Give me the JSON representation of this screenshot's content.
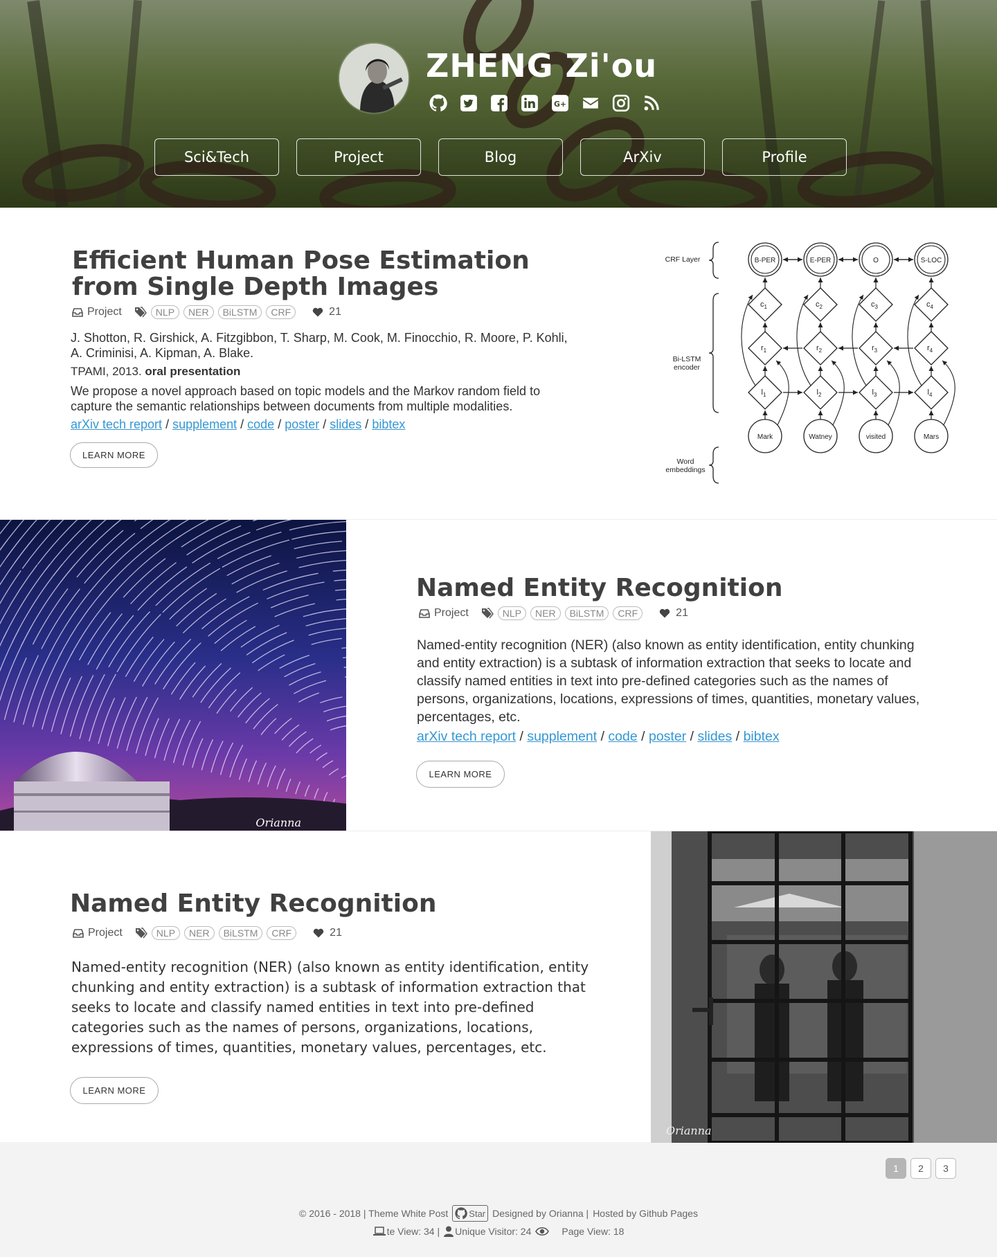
{
  "site": {
    "name": "ZHENG Zi'ou",
    "social_icons": [
      "github-icon",
      "twitter-icon",
      "facebook-icon",
      "linkedin-icon",
      "google-plus-icon",
      "email-icon",
      "instagram-icon",
      "rss-icon"
    ]
  },
  "nav": [
    "Sci&Tech",
    "Project",
    "Blog",
    "ArXiv",
    "Profile"
  ],
  "posts": [
    {
      "title": "Efficient Human Pose Estimation from Single Depth Images",
      "category": "Project",
      "tags": [
        "NLP",
        "NER",
        "BiLSTM",
        "CRF"
      ],
      "likes": "21",
      "authors": "J. Shotton, R. Girshick, A. Fitzgibbon, T. Sharp, M. Cook, M. Finocchio, R. Moore, P. Kohli, A. Criminisi, A. Kipman, A. Blake.",
      "venue": "TPAMI, 2013.",
      "venue_note": "oral presentation",
      "abstract": "We propose a novel approach based on topic models and the Markov random field to capture the semantic relationships between documents from multiple modalities.",
      "links": [
        "arXiv tech report",
        "supplement",
        "code",
        "poster",
        "slides",
        "bibtex"
      ],
      "button": "LEARN MORE"
    },
    {
      "title": "Named Entity Recognition",
      "category": "Project",
      "tags": [
        "NLP",
        "NER",
        "BiLSTM",
        "CRF"
      ],
      "likes": "21",
      "abstract": "Named-entity recognition (NER) (also known as entity identification, entity chunking and entity extraction) is a subtask of information extraction that seeks to locate and classify named entities in text into pre-defined categories such as the names of persons, organizations, locations, expressions of times, quantities, monetary values, percentages, etc.",
      "links": [
        "arXiv tech report",
        "supplement",
        "code",
        "poster",
        "slides",
        "bibtex"
      ],
      "button": "LEARN MORE",
      "photo_signature": "Orianna"
    },
    {
      "title": "Named Entity Recognition",
      "category": "Project",
      "tags": [
        "NLP",
        "NER",
        "BiLSTM",
        "CRF"
      ],
      "likes": "21",
      "abstract": "Named-entity recognition (NER) (also known as entity identification, entity chunking and entity extraction) is a subtask of information extraction that seeks to locate and classify named entities in text into pre-defined categories such as the names of persons, organizations, locations, expressions of times, quantities, monetary values, percentages, etc.",
      "button": "LEARN MORE",
      "photo_signature": "Orianna"
    }
  ],
  "diagram": {
    "row_labels": [
      "CRF Layer",
      "Bi-LSTM",
      "encoder",
      "Word",
      "embeddings"
    ],
    "crf": [
      "B-PER",
      "E-PER",
      "O",
      "S-LOC"
    ],
    "c": [
      "c",
      "c",
      "c",
      "c"
    ],
    "r": [
      "r",
      "r",
      "r",
      "r"
    ],
    "l": [
      "l",
      "l",
      "l",
      "l"
    ],
    "sub": [
      "1",
      "2",
      "3",
      "4"
    ],
    "words": [
      "Mark",
      "Watney",
      "visited",
      "Mars"
    ]
  },
  "pagination": [
    "1",
    "2",
    "3"
  ],
  "footer": {
    "copyright": "© 2016 - 2018 | Theme White Post",
    "star": "Star",
    "designed": "Designed by Orianna |",
    "hosted": "Hosted by Github Pages",
    "site_view": "te View: 34 |",
    "unique_visitor": "Unique Visitor: 24",
    "page_view": "Page View: 18"
  }
}
